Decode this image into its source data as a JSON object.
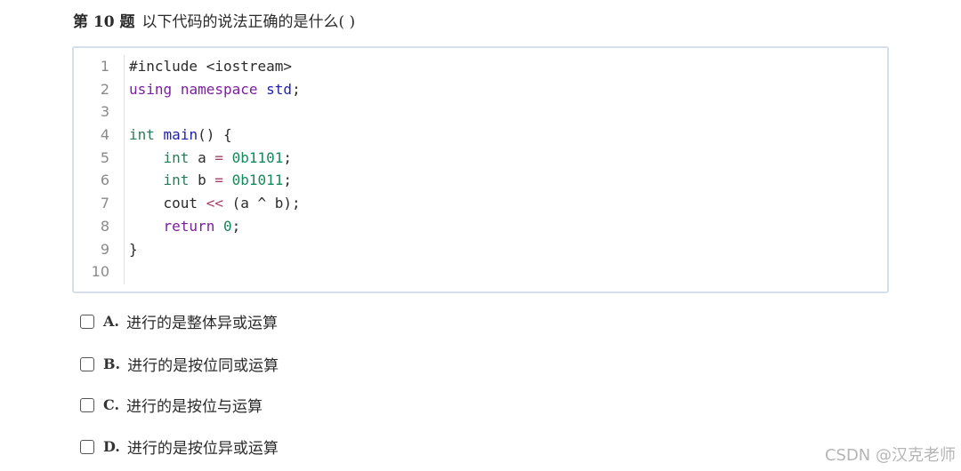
{
  "question": {
    "number": "第 10 题",
    "text": "以下代码的说法正确的是什么( )"
  },
  "code": {
    "line_numbers": [
      "1",
      "2",
      "3",
      "4",
      "5",
      "6",
      "7",
      "8",
      "9",
      "10"
    ],
    "lines": [
      "#include <iostream>",
      "using namespace std;",
      "",
      "int main() {",
      "    int a = 0b1101;",
      "    int b = 0b1011;",
      "    cout << (a ^ b);",
      "    return 0;",
      "}",
      ""
    ]
  },
  "options": [
    {
      "letter": "A.",
      "text": "进行的是整体异或运算"
    },
    {
      "letter": "B.",
      "text": "进行的是按位同或运算"
    },
    {
      "letter": "C.",
      "text": "进行的是按位与运算"
    },
    {
      "letter": "D.",
      "text": "进行的是按位异或运算"
    }
  ],
  "watermark": "CSDN @汉克老师",
  "colors": {
    "keyword_purple": "#7a1f9e",
    "keyword_green": "#2a7a5a",
    "keyword_blue": "#1e22aa",
    "number_green": "#138a5a",
    "operator_red": "#a5426c",
    "border": "#d6dfe9"
  }
}
